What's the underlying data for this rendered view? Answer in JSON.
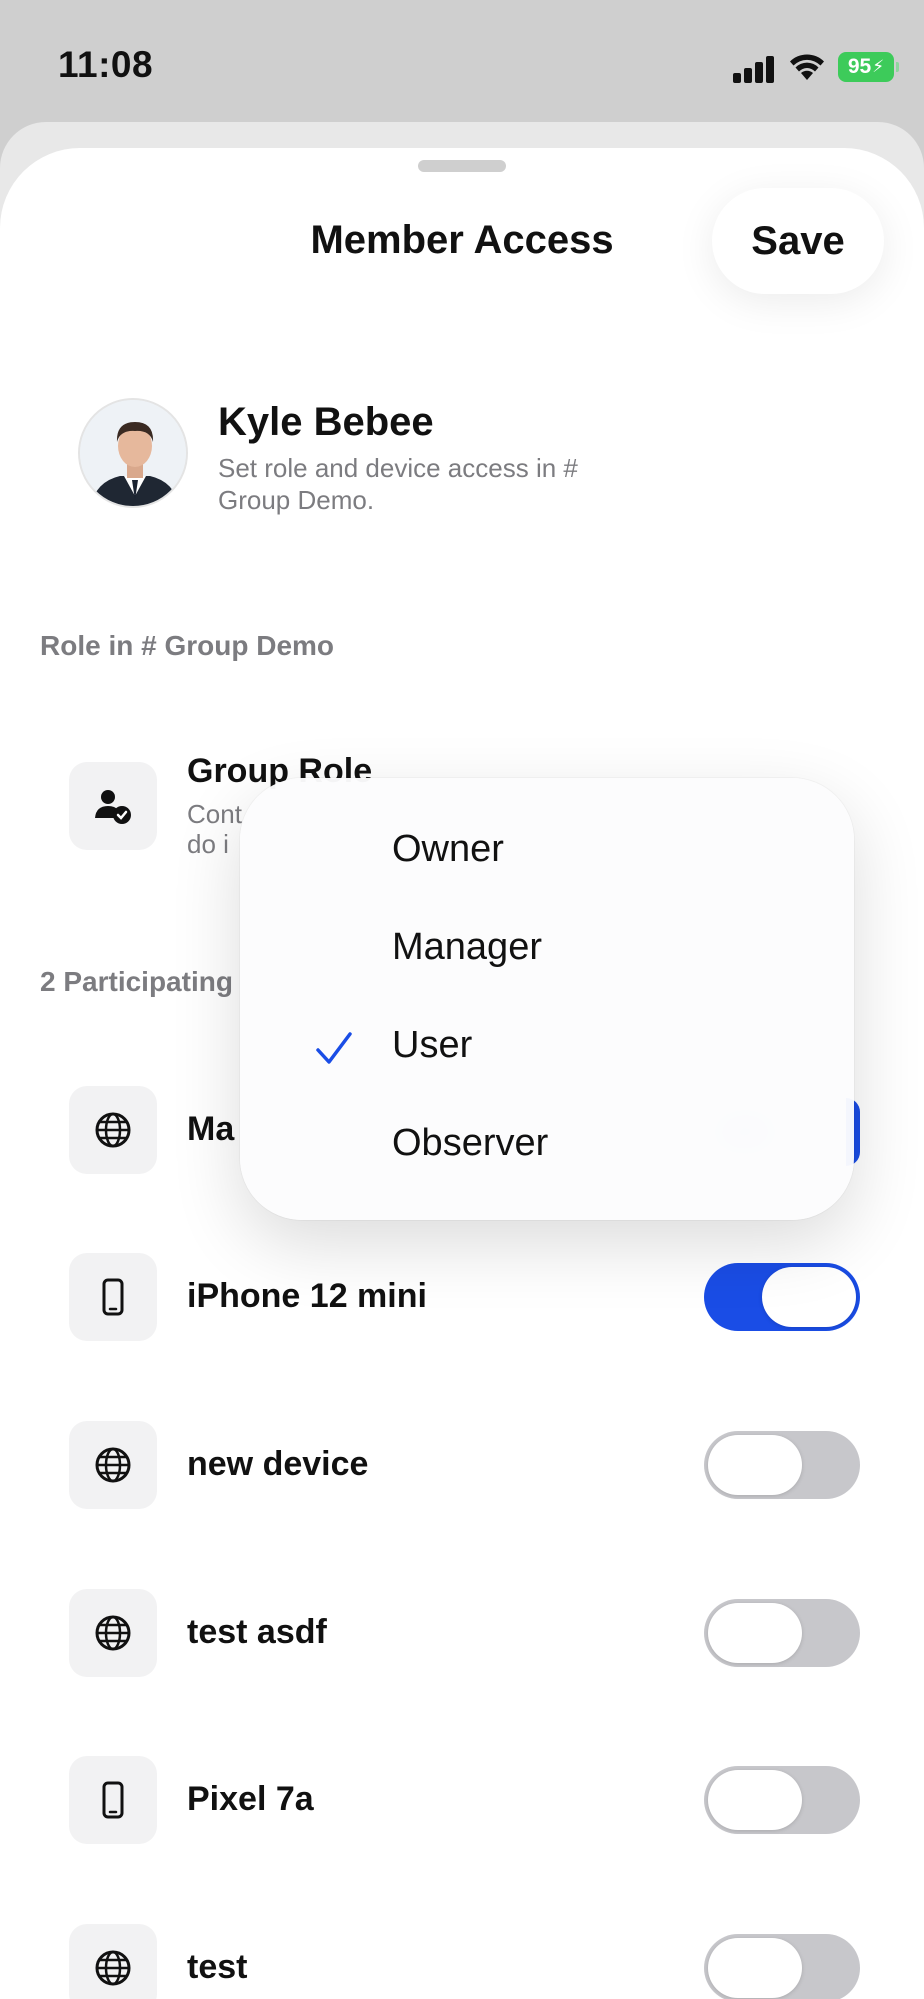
{
  "status": {
    "time": "11:08",
    "battery": "95"
  },
  "sheet": {
    "title": "Member Access",
    "save_label": "Save"
  },
  "member": {
    "name": "Kyle Bebee",
    "subtitle": "Set role and device access in # Group Demo."
  },
  "role_section": {
    "label": "Role in # Group Demo",
    "row_title": "Group Role",
    "row_subtitle": "Cont",
    "row_subtitle_line2": "do i"
  },
  "devices_section": {
    "label": "2 Participating",
    "devices": [
      {
        "name": "Ma",
        "icon": "globe-icon",
        "enabled": true
      },
      {
        "name": "iPhone 12 mini",
        "icon": "phone-icon",
        "enabled": true
      },
      {
        "name": "new device",
        "icon": "globe-icon",
        "enabled": false
      },
      {
        "name": "test asdf",
        "icon": "globe-icon",
        "enabled": false
      },
      {
        "name": "Pixel 7a",
        "icon": "phone-icon",
        "enabled": false
      },
      {
        "name": "test",
        "icon": "globe-icon",
        "enabled": false
      }
    ]
  },
  "role_menu": {
    "options": [
      "Owner",
      "Manager",
      "User",
      "Observer"
    ],
    "selected": "User"
  },
  "colors": {
    "accent": "#1a4de6",
    "battery": "#3dcb5a"
  }
}
